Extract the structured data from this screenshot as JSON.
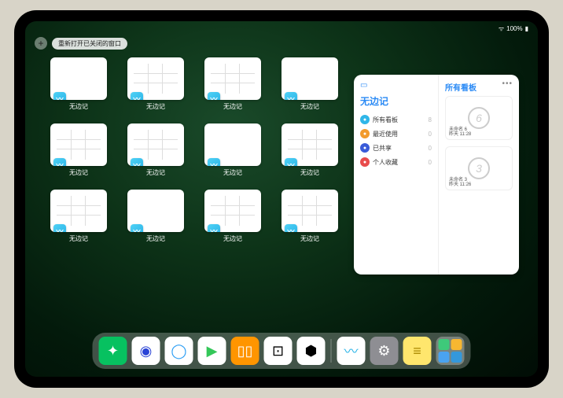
{
  "statusbar": {
    "time": "",
    "battery": "100%"
  },
  "topbar": {
    "plus": "+",
    "reopen_label": "重新打开已关闭的窗口"
  },
  "app_label": "无边记",
  "thumbs": [
    {
      "label": "无边记",
      "variant": "blank"
    },
    {
      "label": "无边记",
      "variant": "grid"
    },
    {
      "label": "无边记",
      "variant": "grid"
    },
    {
      "label": "无边记",
      "variant": "blank"
    },
    {
      "label": "无边记",
      "variant": "grid"
    },
    {
      "label": "无边记",
      "variant": "grid"
    },
    {
      "label": "无边记",
      "variant": "blank"
    },
    {
      "label": "无边记",
      "variant": "grid"
    },
    {
      "label": "无边记",
      "variant": "grid"
    },
    {
      "label": "无边记",
      "variant": "blank"
    },
    {
      "label": "无边记",
      "variant": "grid"
    },
    {
      "label": "无边记",
      "variant": "grid"
    }
  ],
  "panel": {
    "title": "无边记",
    "right_title": "所有看板",
    "items": [
      {
        "icon_color": "#2fb6e8",
        "label": "所有看板",
        "count": "8"
      },
      {
        "icon_color": "#f29b2c",
        "label": "最近使用",
        "count": "0"
      },
      {
        "icon_color": "#3a5bd8",
        "label": "已共享",
        "count": "0"
      },
      {
        "icon_color": "#e84c4c",
        "label": "个人收藏",
        "count": "0"
      }
    ],
    "boards": [
      {
        "scribble": "6",
        "name": "未命名 6",
        "time": "昨天 11:28"
      },
      {
        "scribble": "3",
        "name": "未命名 3",
        "time": "昨天 11:26"
      }
    ]
  },
  "dock": [
    {
      "name": "wechat-icon",
      "bg": "#07c160",
      "glyph": "✦"
    },
    {
      "name": "quark-icon",
      "bg": "#ffffff",
      "glyph": "◉",
      "fg": "#2a44d6"
    },
    {
      "name": "browser-icon",
      "bg": "#ffffff",
      "glyph": "◯",
      "fg": "#2a9df4"
    },
    {
      "name": "play-icon",
      "bg": "#ffffff",
      "glyph": "▶",
      "fg": "#34c759"
    },
    {
      "name": "books-icon",
      "bg": "#ff9500",
      "glyph": "▯▯",
      "fg": "#fff"
    },
    {
      "name": "dice-icon",
      "bg": "#ffffff",
      "glyph": "⊡",
      "fg": "#000"
    },
    {
      "name": "graph-icon",
      "bg": "#ffffff",
      "glyph": "⬢",
      "fg": "#000"
    },
    {
      "name": "freeform-icon",
      "bg": "#ffffff",
      "glyph": "〰",
      "fg": "#2ab4e8"
    },
    {
      "name": "settings-icon",
      "bg": "#8e8e93",
      "glyph": "⚙"
    },
    {
      "name": "notes-icon",
      "bg": "#ffe66d",
      "glyph": "≡",
      "fg": "#aa8800"
    }
  ]
}
